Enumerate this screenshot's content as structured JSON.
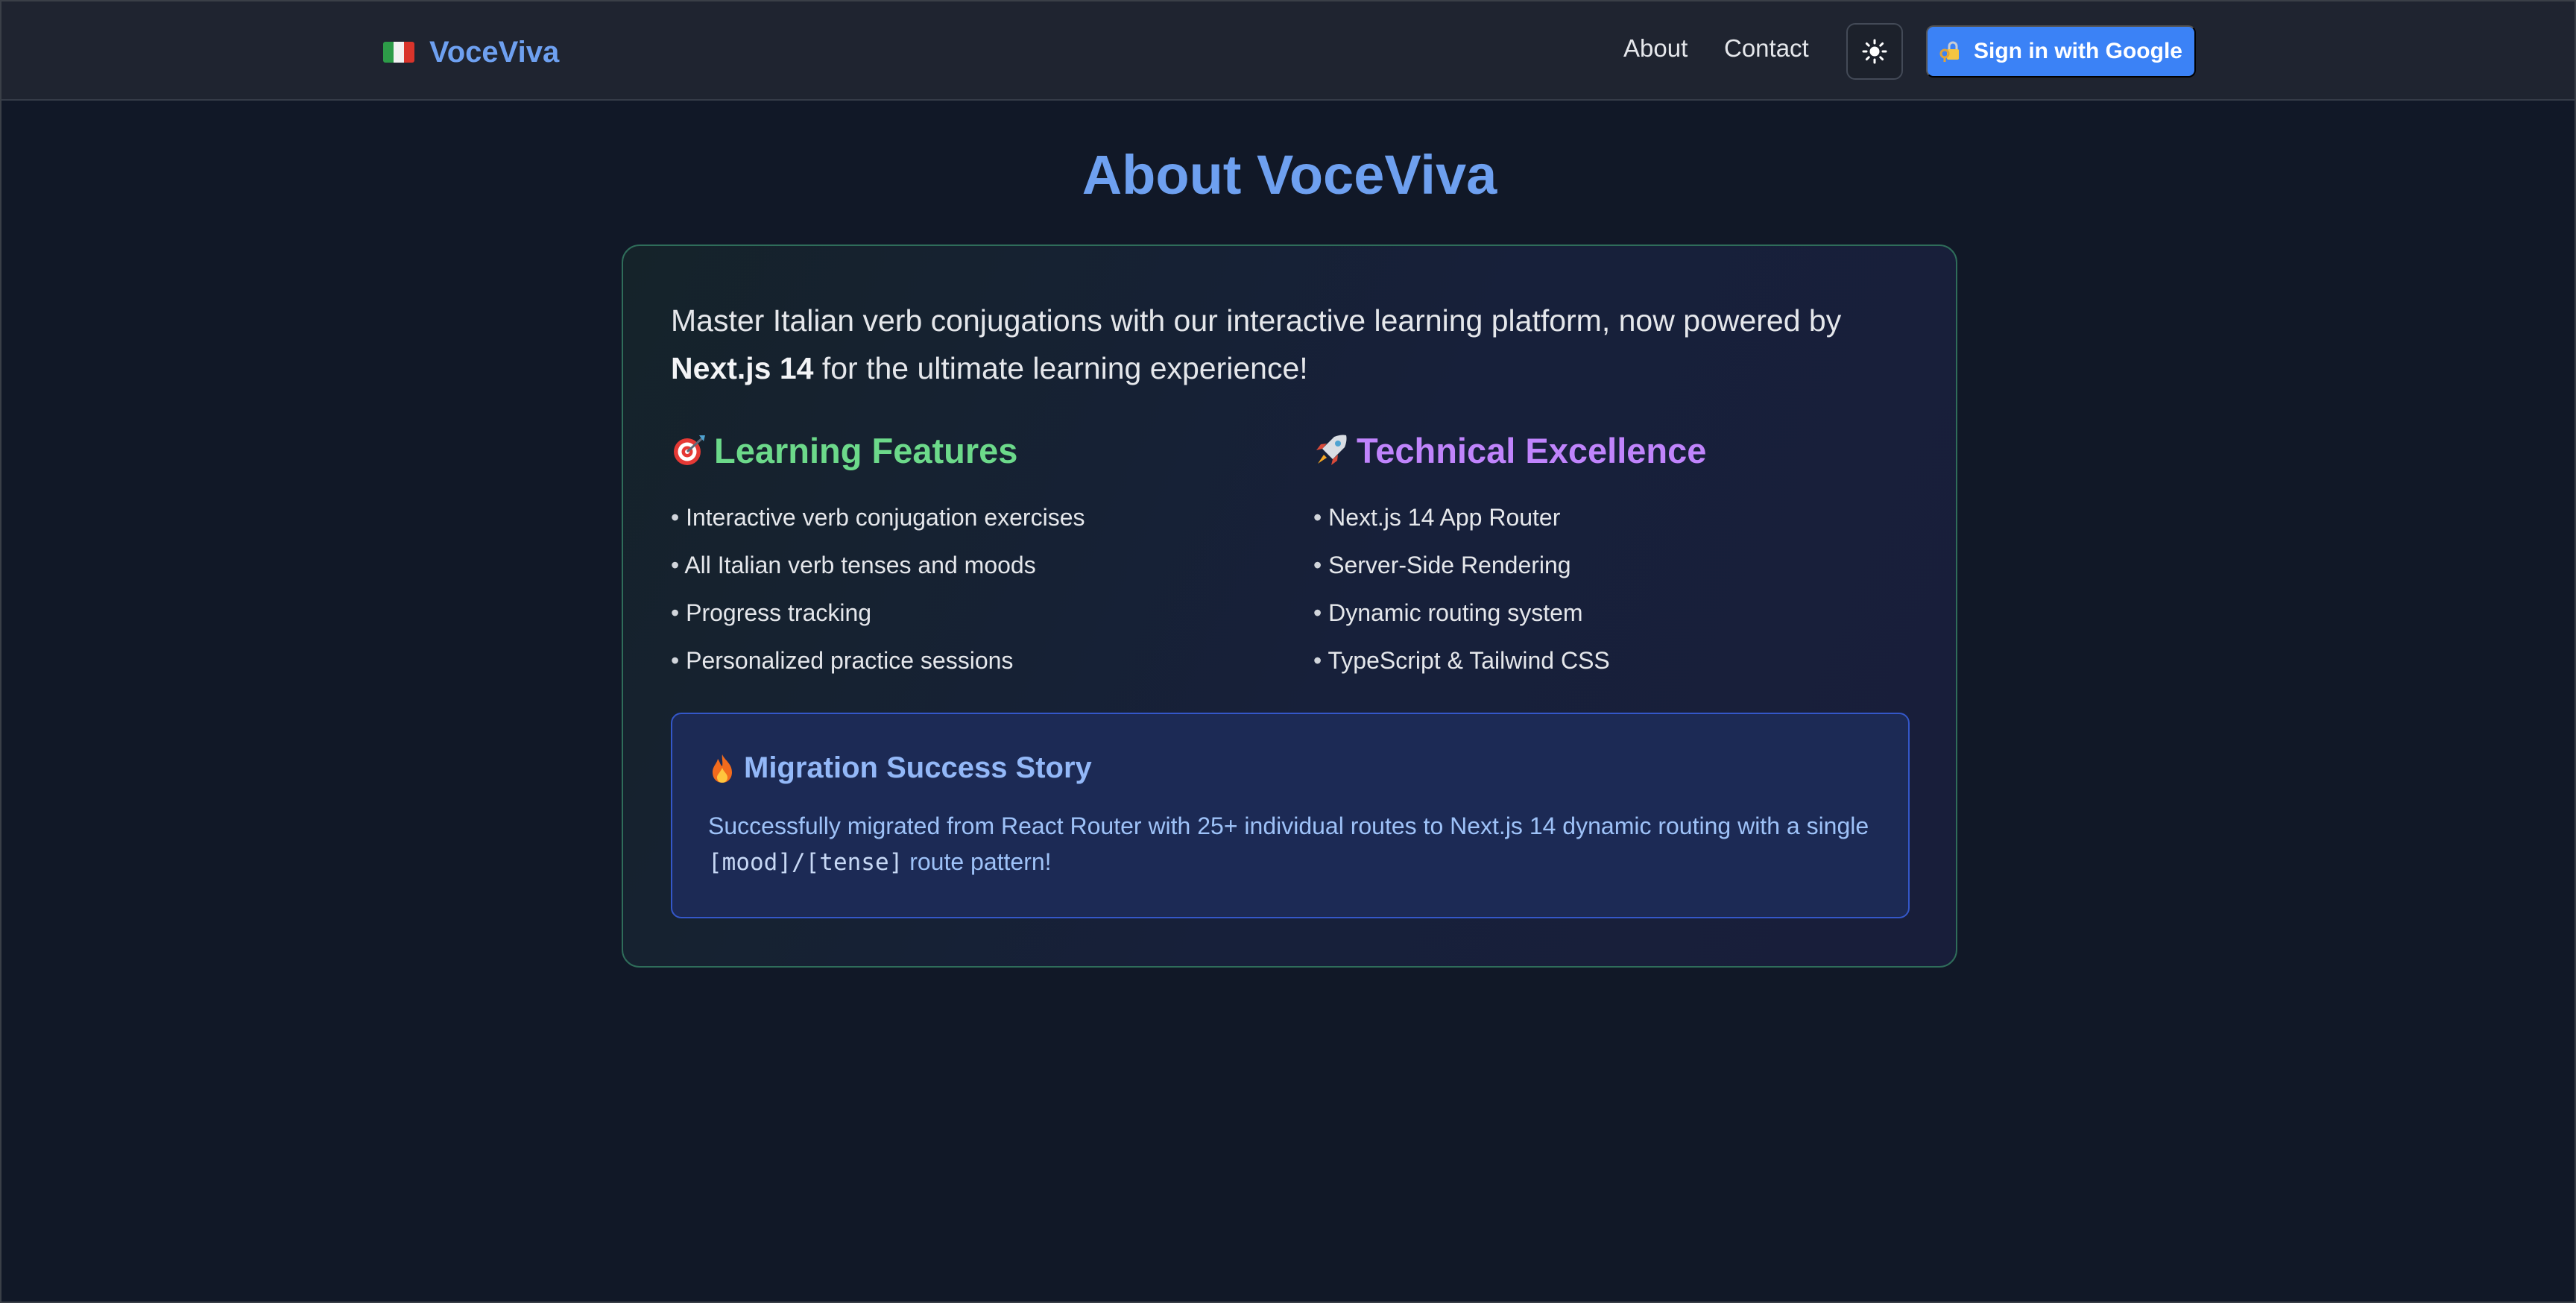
{
  "app": {
    "brand_name": "VoceViva",
    "brand_flag_icon": "italian-flag-icon"
  },
  "nav": {
    "about": "About",
    "contact": "Contact",
    "theme_toggle_icon": "sun-icon",
    "signin_label": "Sign in with Google",
    "signin_icon": "key-lock-icon"
  },
  "page": {
    "title": "About VoceViva",
    "intro_prefix": "Master Italian verb conjugations with our interactive learning platform, now powered by ",
    "intro_bold": "Next.js 14",
    "intro_suffix": " for the ultimate learning experience!"
  },
  "learning": {
    "icon": "target-icon",
    "heading": "Learning Features",
    "items": [
      "Interactive verb conjugation exercises",
      "All Italian verb tenses and moods",
      "Progress tracking",
      "Personalized practice sessions"
    ]
  },
  "technical": {
    "icon": "rocket-icon",
    "heading": "Technical Excellence",
    "items": [
      "Next.js 14 App Router",
      "Server-Side Rendering",
      "Dynamic routing system",
      "TypeScript & Tailwind CSS"
    ]
  },
  "migration": {
    "icon": "fire-icon",
    "heading": "Migration Success Story",
    "body_prefix": "Successfully migrated from React Router with 25+ individual routes to Next.js 14 dynamic routing with a single ",
    "code": "[mood]/[tense]",
    "body_suffix": " route pattern!"
  },
  "colors": {
    "background": "#111827",
    "navbar": "#1f2430",
    "accent_blue": "#6ea0f0",
    "button_blue": "#3b82f6",
    "learning_green": "#6cd98a",
    "technical_purple": "#c084fc",
    "migration_text": "#9ec2f8"
  }
}
